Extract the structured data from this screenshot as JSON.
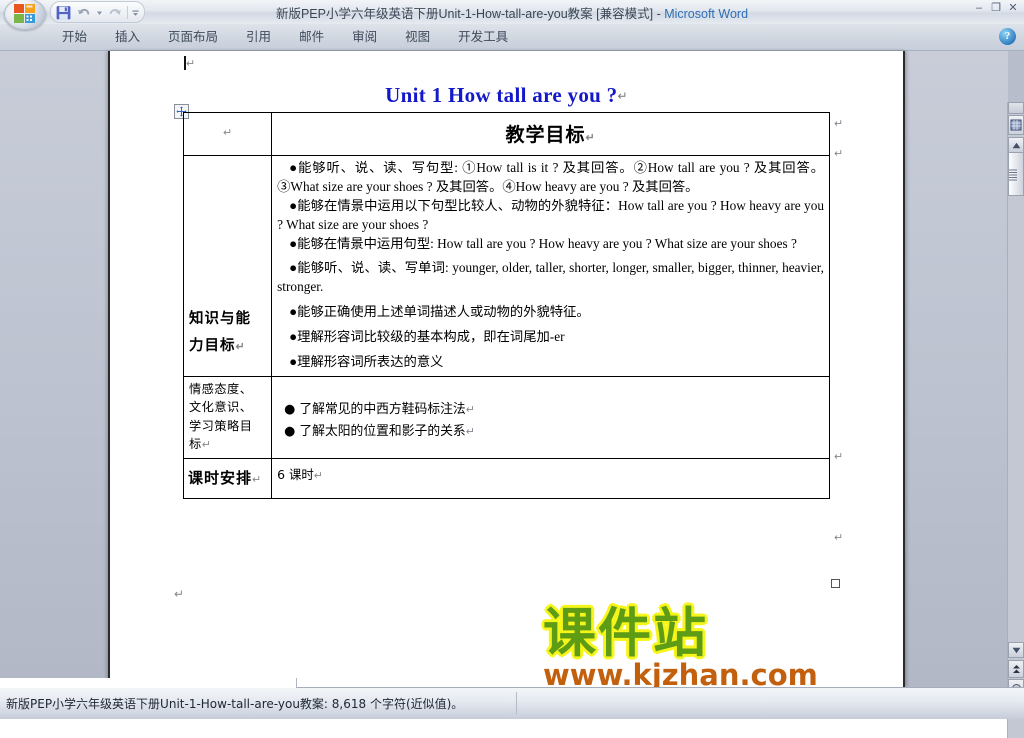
{
  "window": {
    "title_cn": "新版PEP小学六年级英语下册Unit-1-How-tall-are-you教案 [兼容模式]",
    "title_sep": " - ",
    "title_app": "Microsoft Word",
    "minimize": "–",
    "restore": "❐",
    "close": "✕"
  },
  "quick_access": {
    "save": "save-icon",
    "undo": "undo-icon",
    "undo_dropdown": "chevron-down-icon",
    "redo": "redo-icon",
    "customize": "customize-qat-icon"
  },
  "ribbon": {
    "tabs": [
      {
        "label": "开始"
      },
      {
        "label": "插入"
      },
      {
        "label": "页面布局"
      },
      {
        "label": "引用"
      },
      {
        "label": "邮件"
      },
      {
        "label": "审阅"
      },
      {
        "label": "视图"
      },
      {
        "label": "开发工具"
      }
    ],
    "help": "?"
  },
  "document": {
    "heading": "Unit 1    How tall are you ?",
    "pilcrow": "↵",
    "table": {
      "header_row": {
        "label_cell": "↵",
        "title": "教学目标"
      },
      "rows": [
        {
          "label": "知识与能力目标",
          "label_line1": "知识与能",
          "label_line2": "力目标",
          "paragraphs": [
            "●能够听、说、读、写句型: ①How tall is it ? 及其回答。②How tall are you ? 及其回答。③What size are your shoes ? 及其回答。④How heavy are you ? 及其回答。",
            "●能够在情景中运用以下句型比较人、动物的外貌特征：How tall are you ? How heavy are you ? What size are your shoes ?",
            "●能够在情景中运用句型: How tall are you ? How heavy are you ? What size are your shoes ?",
            "●能够听、说、读、写单词: younger, older, taller, shorter, longer, smaller, bigger, thinner, heavier, stronger.",
            "●能够正确使用上述单词描述人或动物的外貌特征。",
            "●理解形容词比较级的基本构成，即在词尾加-er",
            "●理解形容词所表达的意义"
          ]
        },
        {
          "label": "情感态度、文化意识、学习策略目标",
          "label_lines": [
            "情感态度、",
            "文化意识、",
            "学习策略目",
            "标"
          ],
          "bullets": [
            "● 了解常见的中西方鞋码标注法",
            "● 了解太阳的位置和影子的关系"
          ]
        },
        {
          "label": "课时安排",
          "value": "6 课时"
        }
      ]
    },
    "table_move_handle": "table-move-handle-icon"
  },
  "watermark": {
    "brand": "课件站",
    "url": "www.kjzhan.com",
    "brand_color": "#5f9c16",
    "brand_outline_color": "#f5f51a",
    "url_color": "#c2600d"
  },
  "scrollbar": {
    "up_arrow": "▲",
    "down_arrow": "▼",
    "prev_page": "⮝",
    "browse_object": "●",
    "next_page": "⮟",
    "split_handle": "split-window-handle"
  },
  "statusbar": {
    "text": "新版PEP小学六年级英语下册Unit-1-How-tall-are-you教案: 8,618 个字符(近似值)。"
  },
  "colors": {
    "heading_blue": "#1318c8",
    "titlebar_app_blue": "#2f6fb5"
  }
}
